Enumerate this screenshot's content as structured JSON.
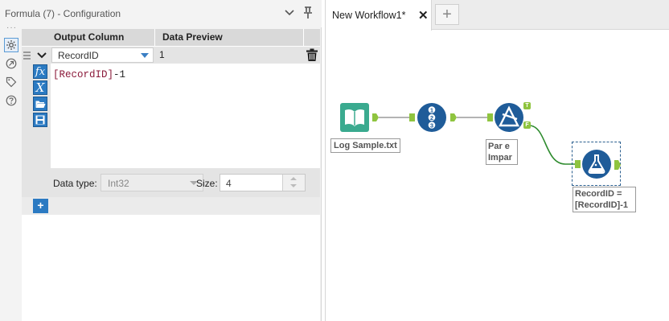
{
  "config": {
    "title": "Formula (7) - Configuration",
    "headers": {
      "output_column": "Output Column",
      "data_preview": "Data Preview"
    },
    "row": {
      "output_column": "RecordID",
      "preview": "1"
    },
    "expression": {
      "field": "[RecordID]",
      "operator": "-",
      "number": "1"
    },
    "data_type_label": "Data type:",
    "data_type_value": "Int32",
    "size_label": "Size:",
    "size_value": "4",
    "add_label": "+"
  },
  "rail": {
    "dots": "···",
    "items": [
      "configuration-icon",
      "annotation-icon",
      "tag-icon",
      "help-icon"
    ]
  },
  "formula_tools": [
    "fx",
    "X",
    "open-folder",
    "save"
  ],
  "tabs": {
    "active": "New Workflow1*",
    "close": "✕",
    "add": "+"
  },
  "workflow": {
    "tools": [
      {
        "name": "input",
        "label": "Log Sample.txt"
      },
      {
        "name": "recordid",
        "label": ""
      },
      {
        "name": "filter",
        "label": "Par e\nImpar",
        "true_anchor": "T",
        "false_anchor": "F"
      },
      {
        "name": "formula",
        "label": "RecordID =\n[RecordID]-1"
      }
    ]
  },
  "colors": {
    "accent_blue": "#2b7ac2",
    "tool_blue": "#1f5c99",
    "input_green": "#3aaa8f",
    "anchor_green": "#8fc43f",
    "wire_green": "#2e8b2e"
  }
}
